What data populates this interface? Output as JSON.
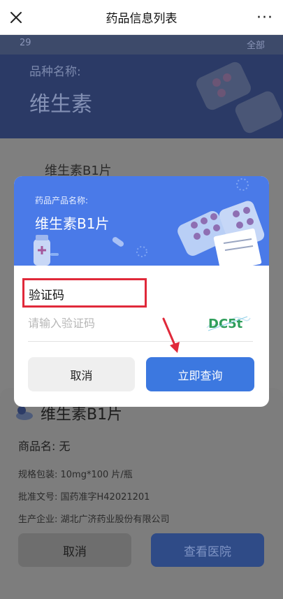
{
  "navbar": {
    "title": "药品信息列表",
    "more_label": "···"
  },
  "background": {
    "top_left": "29",
    "top_right": "全部",
    "hero_label": "品种名称:",
    "hero_value": "维生素",
    "list_item": "维生素B1片"
  },
  "sheet": {
    "title": "维生素B1片",
    "product_name": "商品名: 无",
    "spec": "规格包装: 10mg*100 片/瓶",
    "approval": "批准文号: 国药准字H42021201",
    "manufacturer": "生产企业: 湖北广济药业股份有限公司",
    "cancel_label": "取消",
    "hospital_label": "查看医院"
  },
  "modal": {
    "header_label": "药品产品名称:",
    "header_value": "维生素B1片",
    "captcha_label": "验证码",
    "captcha_placeholder": "请输入验证码",
    "captcha_value": "",
    "captcha_image_text": "DC5t",
    "cancel_label": "取消",
    "query_label": "立即查询"
  },
  "colors": {
    "accent": "#3c78e0",
    "header_blue": "#4a7ae8",
    "highlight_red": "#e0293a",
    "overlay_dark": "#2b3a66"
  },
  "icons": [
    "close-icon",
    "more-icon",
    "pill-icon",
    "arrow-annotation-icon"
  ]
}
